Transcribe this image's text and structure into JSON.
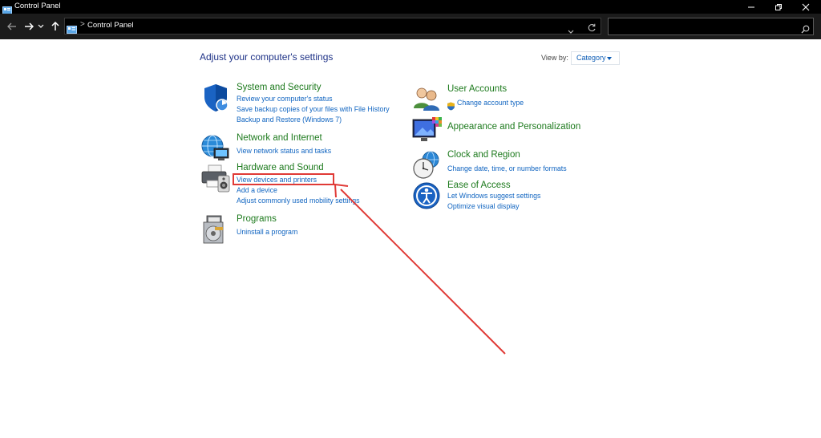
{
  "window": {
    "title": "Control Panel"
  },
  "address_bar": {
    "separator": ">",
    "crumb": "Control Panel",
    "search_value": ""
  },
  "content": {
    "heading": "Adjust your computer's settings",
    "view_by": {
      "label": "View by:",
      "selected": "Category"
    },
    "categories_left": [
      {
        "title": "System and Security",
        "icon": "shield-icon",
        "links": [
          "Review your computer's status",
          "Save backup copies of your files with File History",
          "Backup and Restore (Windows 7)"
        ]
      },
      {
        "title": "Network and Internet",
        "icon": "globe-network-icon",
        "links": [
          "View network status and tasks"
        ]
      },
      {
        "title": "Hardware and Sound",
        "icon": "printer-speaker-icon",
        "links": [
          "View devices and printers",
          "Add a device",
          "Adjust commonly used mobility settings"
        ]
      },
      {
        "title": "Programs",
        "icon": "programs-disc-icon",
        "links": [
          "Uninstall a program"
        ]
      }
    ],
    "categories_right": [
      {
        "title": "User Accounts",
        "icon": "users-icon",
        "links": [
          "Change account type"
        ]
      },
      {
        "title": "Appearance and Personalization",
        "icon": "monitor-palette-icon",
        "links": []
      },
      {
        "title": "Clock and Region",
        "icon": "clock-globe-icon",
        "links": [
          "Change date, time, or number formats"
        ]
      },
      {
        "title": "Ease of Access",
        "icon": "accessibility-icon",
        "links": [
          "Let Windows suggest settings",
          "Optimize visual display"
        ]
      }
    ]
  },
  "colors": {
    "category_title": "#1d7a1d",
    "link": "#1165c1",
    "heading": "#1e3287",
    "annotation": "#e03a36"
  }
}
